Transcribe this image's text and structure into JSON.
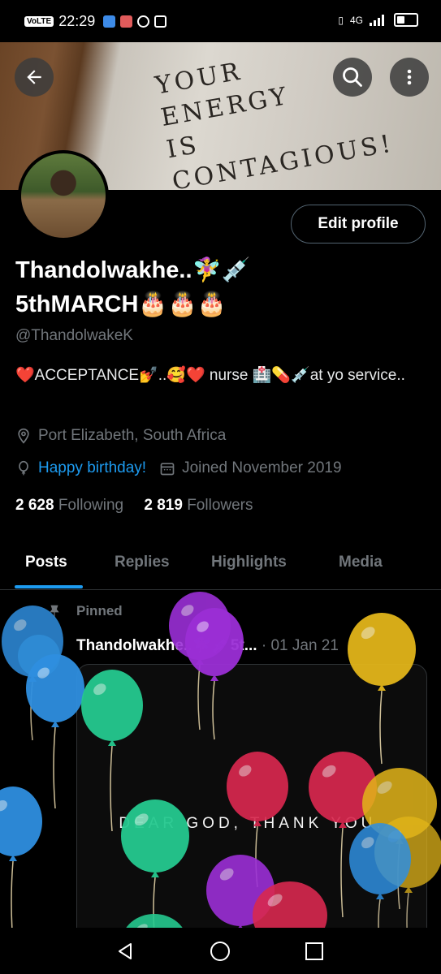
{
  "status_bar": {
    "volte": "VoLTE",
    "time": "22:29",
    "network": "4G",
    "battery_level": 0.4
  },
  "banner": {
    "text": "YOUR\nENERGY\nIS\nCONTAGIOUS!"
  },
  "header": {
    "back_icon": "arrow-left-icon",
    "search_icon": "search-icon",
    "more_icon": "more-vertical-icon"
  },
  "profile": {
    "edit_label": "Edit profile",
    "name_line1": "Thandolwakhe..🧚‍♀️💉",
    "name_line2": "5thMARCH🎂🎂🎂",
    "handle": "@ThandolwakeK",
    "bio": "❤️ACCEPTANCE💅..🥰❤️  nurse 🏥💊💉at yo service..",
    "location": "Port Elizabeth, South Africa",
    "birthday_link": "Happy birthday!",
    "joined": "Joined November 2019",
    "following_count": "2 628",
    "following_label": "Following",
    "followers_count": "2 819",
    "followers_label": "Followers"
  },
  "tabs": [
    {
      "label": "Posts",
      "active": true
    },
    {
      "label": "Replies",
      "active": false
    },
    {
      "label": "Highlights",
      "active": false
    },
    {
      "label": "Media",
      "active": false
    }
  ],
  "pinned_post": {
    "pinned_label": "Pinned",
    "author": "Thandolwakhe..🧚‍♀️💉5t...",
    "date": "· 01 Jan 21",
    "media_text": "DEAR GOD, THANK YOU."
  },
  "colors": {
    "accent": "#1d9bf0",
    "secondary_text": "#71767b",
    "balloon_blue": "#2f8fe0",
    "balloon_purple": "#9b2fd6",
    "balloon_green": "#25c98f",
    "balloon_red": "#d8284f",
    "balloon_yellow": "#e2b51a"
  }
}
